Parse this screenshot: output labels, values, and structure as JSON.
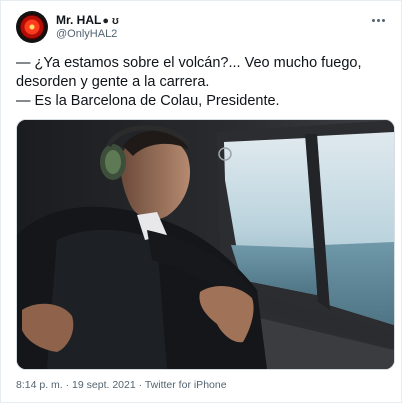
{
  "author": {
    "display_name": "Mr. HAL",
    "name_glyphs": "● ʊ",
    "handle": "@OnlyHAL2"
  },
  "tweet": {
    "lines": [
      "— ¿Ya estamos sobre el volcán?... Veo mucho fuego,",
      "desorden y gente a la carrera.",
      "— Es la Barcelona de Colau, Presidente."
    ]
  },
  "meta": {
    "time": "8:14 p. m.",
    "separator1": " · ",
    "date": "19 sept. 2021",
    "separator2": " · ",
    "source": "Twitter for iPhone"
  },
  "icons": {
    "avatar": "hal-9000-eye-icon",
    "more": "more-options-icon"
  },
  "colors": {
    "text": "#0f1419",
    "secondary": "#536471",
    "border": "#e6ecf0"
  }
}
